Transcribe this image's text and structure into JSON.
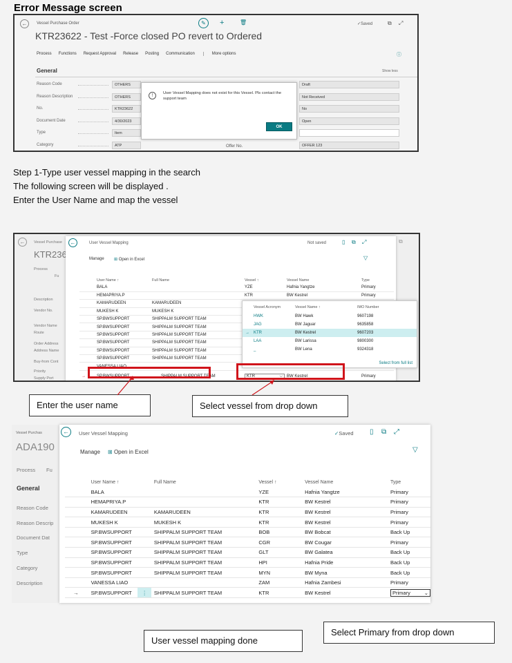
{
  "heading": "Error Message screen",
  "screen1": {
    "breadcrumb": "Vessel Purchase Order",
    "title": "KTR23622 - Test -Force closed PO revert to Ordered",
    "saved": "Saved",
    "menu": [
      "Process",
      "Functions",
      "Request Approval",
      "Release",
      "Posting",
      "Communication",
      "More options"
    ],
    "section": "General",
    "show_less": "Show less",
    "fields_left": [
      {
        "label": "Reason Code",
        "value": "OTHERS"
      },
      {
        "label": "Reason Description",
        "value": "OTHERS"
      },
      {
        "label": "No.",
        "value": "KTR23622"
      },
      {
        "label": "Document Date",
        "value": "4/30/2023"
      },
      {
        "label": "Type",
        "value": "Item"
      },
      {
        "label": "Category",
        "value": "ATP"
      }
    ],
    "fields_right": [
      "Draft",
      "Not Received",
      "No",
      "Open",
      "",
      "OFFER 123"
    ],
    "offer_label": "Offer No.",
    "dialog": {
      "message": "User Vessel Mapping does not exist for this Vessel. Pls contact the support team",
      "ok": "OK"
    }
  },
  "steps": [
    "Step 1-Type user vessel mapping in the search",
    "The following screen will be displayed .",
    "Enter the User Name and map the vessel"
  ],
  "screen2": {
    "bg_breadcrumb": "Vessel Purchase",
    "bg_title": "KTR236",
    "bg_labels": [
      "Process",
      "Fu",
      "Description",
      "Vendor No.",
      "Vendor Name",
      "Route",
      "Order Address",
      "Address Name",
      "Buy-from Cont",
      "Priority",
      "Supply Port"
    ],
    "page_title": "User Vessel Mapping",
    "status": "Not saved",
    "manage": "Manage",
    "open_excel": "Open in Excel",
    "headers": [
      "User Name ↑",
      "Full Name",
      "Vessel ↑",
      "Vessel Name",
      "Type"
    ],
    "rows": [
      {
        "user": "BALA",
        "full": "",
        "vessel": "YZE",
        "vname": "Hafnia Yangtze",
        "type": "Primary"
      },
      {
        "user": "HEMAPRIYA.P",
        "full": "",
        "vessel": "KTR",
        "vname": "BW Kestrel",
        "type": "Primary"
      },
      {
        "user": "KAMARUDEEN",
        "full": "KAMARUDEEN",
        "vessel": "",
        "vname": "",
        "type": ""
      },
      {
        "user": "MUKESH K",
        "full": "MUKESH K",
        "vessel": "",
        "vname": "",
        "type": ""
      },
      {
        "user": "SP.BWSUPPORT",
        "full": "SHIPPALM SUPPORT TEAM",
        "vessel": "",
        "vname": "",
        "type": ""
      },
      {
        "user": "SP.BWSUPPORT",
        "full": "SHIPPALM SUPPORT TEAM",
        "vessel": "",
        "vname": "",
        "type": ""
      },
      {
        "user": "SP.BWSUPPORT",
        "full": "SHIPPALM SUPPORT TEAM",
        "vessel": "",
        "vname": "",
        "type": ""
      },
      {
        "user": "SP.BWSUPPORT",
        "full": "SHIPPALM SUPPORT TEAM",
        "vessel": "",
        "vname": "",
        "type": ""
      },
      {
        "user": "SP.BWSUPPORT",
        "full": "SHIPPALM SUPPORT TEAM",
        "vessel": "",
        "vname": "",
        "type": ""
      },
      {
        "user": "SP.BWSUPPORT",
        "full": "SHIPPALM SUPPORT TEAM",
        "vessel": "",
        "vname": "",
        "type": ""
      },
      {
        "user": "VANESSA LIAO",
        "full": "",
        "vessel": "",
        "vname": "",
        "type": ""
      }
    ],
    "active_row": {
      "user": "SP.BWSUPPORT",
      "full": "SHIPPALM SUPPORT TEAM",
      "vessel": "KTR",
      "vname": "BW Kestrel",
      "type": "Primary"
    },
    "lookup": {
      "headers": [
        "Vessel Acronym",
        "Vessel Name ↑",
        "IMO Number"
      ],
      "rows": [
        {
          "acr": "HWK",
          "name": "BW Hawk",
          "imo": "9607198"
        },
        {
          "acr": "JAG",
          "name": "BW Jaguar",
          "imo": "9635858"
        },
        {
          "acr": "KTR",
          "name": "BW Kestrel",
          "imo": "9607203"
        },
        {
          "acr": "LAA",
          "name": "BW Larissa",
          "imo": "9800300"
        },
        {
          "acr": "_",
          "name": "BW Lena",
          "imo": "9324318"
        }
      ],
      "select_full": "Select from full list"
    }
  },
  "callouts": {
    "enter_user": "Enter the user name",
    "select_vessel": "Select vessel from drop down",
    "mapping_done": "User vessel mapping done",
    "select_primary": "Select Primary from drop down"
  },
  "screen3": {
    "bg_breadcrumb": "Vessel Purchas",
    "bg_title": "ADA190",
    "bg_labels": [
      "Process",
      "Fu",
      "General",
      "Reason Code",
      "Reason Descrip",
      "Document Dat",
      "Type",
      "Category",
      "Description"
    ],
    "page_title": "User Vessel Mapping",
    "saved": "Saved",
    "manage": "Manage",
    "open_excel": "Open in Excel",
    "headers": [
      "User Name ↑",
      "Full Name",
      "Vessel ↑",
      "Vessel Name",
      "Type"
    ],
    "rows": [
      {
        "user": "BALA",
        "full": "",
        "vessel": "YZE",
        "vname": "Hafnia Yangtze",
        "type": "Primary"
      },
      {
        "user": "HEMAPRIYA.P",
        "full": "",
        "vessel": "KTR",
        "vname": "BW Kestrel",
        "type": "Primary"
      },
      {
        "user": "KAMARUDEEN",
        "full": "KAMARUDEEN",
        "vessel": "KTR",
        "vname": "BW Kestrel",
        "type": "Primary"
      },
      {
        "user": "MUKESH K",
        "full": "MUKESH K",
        "vessel": "KTR",
        "vname": "BW Kestrel",
        "type": "Primary"
      },
      {
        "user": "SP.BWSUPPORT",
        "full": "SHIPPALM SUPPORT TEAM",
        "vessel": "BOB",
        "vname": "BW Bobcat",
        "type": "Back Up"
      },
      {
        "user": "SP.BWSUPPORT",
        "full": "SHIPPALM SUPPORT TEAM",
        "vessel": "CGR",
        "vname": "BW Cougar",
        "type": "Primary"
      },
      {
        "user": "SP.BWSUPPORT",
        "full": "SHIPPALM SUPPORT TEAM",
        "vessel": "GLT",
        "vname": "BW Galatea",
        "type": "Back Up"
      },
      {
        "user": "SP.BWSUPPORT",
        "full": "SHIPPALM SUPPORT TEAM",
        "vessel": "HPI",
        "vname": "Hafnia Pride",
        "type": "Back Up"
      },
      {
        "user": "SP.BWSUPPORT",
        "full": "SHIPPALM SUPPORT TEAM",
        "vessel": "MYN",
        "vname": "BW Myna",
        "type": "Back Up"
      },
      {
        "user": "VANESSA LIAO",
        "full": "",
        "vessel": "ZAM",
        "vname": "Hafnia Zambesi",
        "type": "Primary"
      }
    ],
    "active_row": {
      "user": "SP.BWSUPPORT",
      "full": "SHIPPALM SUPPORT TEAM",
      "vessel": "KTR",
      "vname": "BW Kestrel",
      "type": "Primary"
    }
  }
}
